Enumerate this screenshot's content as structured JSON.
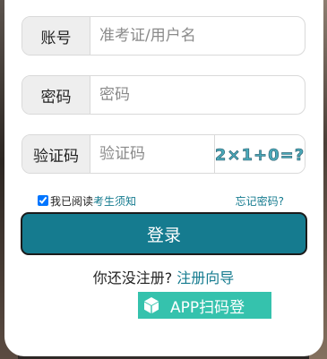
{
  "form": {
    "account": {
      "label": "账号",
      "placeholder": "准考证/用户名",
      "value": ""
    },
    "password": {
      "label": "密码",
      "placeholder": "密码",
      "value": ""
    },
    "captcha": {
      "label": "验证码",
      "placeholder": "验证码",
      "value": "",
      "image_text": "2×1+0=?"
    }
  },
  "agreement": {
    "checked": true,
    "prefix": "我已阅读",
    "link_label": "考生须知"
  },
  "forgot_password_label": "忘记密码?",
  "login_button_label": "登录",
  "register": {
    "prompt": "你还没注册?",
    "link_label": "注册向导"
  },
  "app_login": {
    "label": "APP扫码登",
    "icon": "cube-icon"
  },
  "colors": {
    "primary": "#157b8f",
    "app_button": "#35c2ad",
    "label_bg": "#eeeeee"
  }
}
